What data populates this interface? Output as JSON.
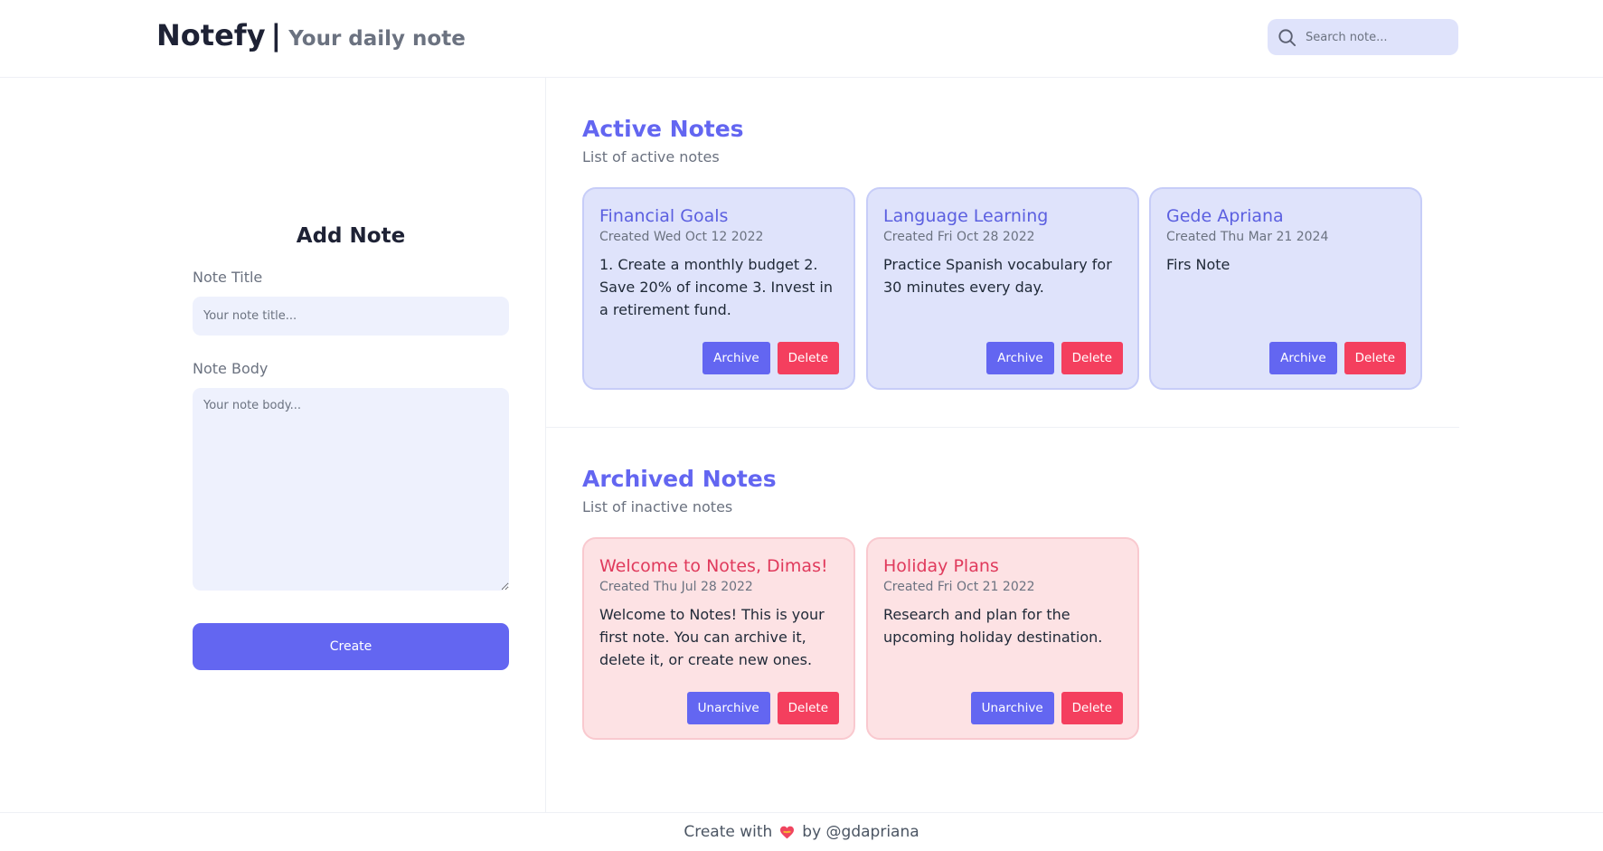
{
  "header": {
    "brand_name": "Notefy",
    "brand_separator": "|",
    "brand_tagline": "Your daily note",
    "search_placeholder": "Search note..."
  },
  "add_note": {
    "heading": "Add Note",
    "title_label": "Note Title",
    "title_placeholder": "Your note title...",
    "body_label": "Note Body",
    "body_placeholder": "Your note body...",
    "create_label": "Create"
  },
  "active": {
    "title": "Active Notes",
    "subtitle": "List of active notes",
    "notes": [
      {
        "title": "Financial Goals",
        "date": "Created Wed Oct 12 2022",
        "body": "1. Create a monthly budget 2. Save 20% of income 3. Invest in a retirement fund.",
        "archive_label": "Archive",
        "delete_label": "Delete"
      },
      {
        "title": "Language Learning",
        "date": "Created Fri Oct 28 2022",
        "body": "Practice Spanish vocabulary for 30 minutes every day.",
        "archive_label": "Archive",
        "delete_label": "Delete"
      },
      {
        "title": "Gede Apriana",
        "date": "Created Thu Mar 21 2024",
        "body": "Firs Note",
        "archive_label": "Archive",
        "delete_label": "Delete"
      }
    ]
  },
  "archived": {
    "title": "Archived Notes",
    "subtitle": "List of inactive notes",
    "notes": [
      {
        "title": "Welcome to Notes, Dimas!",
        "date": "Created Thu Jul 28 2022",
        "body": "Welcome to Notes! This is your first note. You can archive it, delete it, or create new ones.",
        "unarchive_label": "Unarchive",
        "delete_label": "Delete"
      },
      {
        "title": "Holiday Plans",
        "date": "Created Fri Oct 21 2022",
        "body": "Research and plan for the upcoming holiday destination.",
        "unarchive_label": "Unarchive",
        "delete_label": "Delete"
      }
    ]
  },
  "footer": {
    "prefix": "Create with",
    "icon": "heart-icon",
    "suffix": "by @gdapriana"
  },
  "colors": {
    "accent": "#6366f1",
    "danger": "#f43f5e",
    "active_card_bg": "#dfe3fb",
    "archived_card_bg": "#fde2e4"
  }
}
